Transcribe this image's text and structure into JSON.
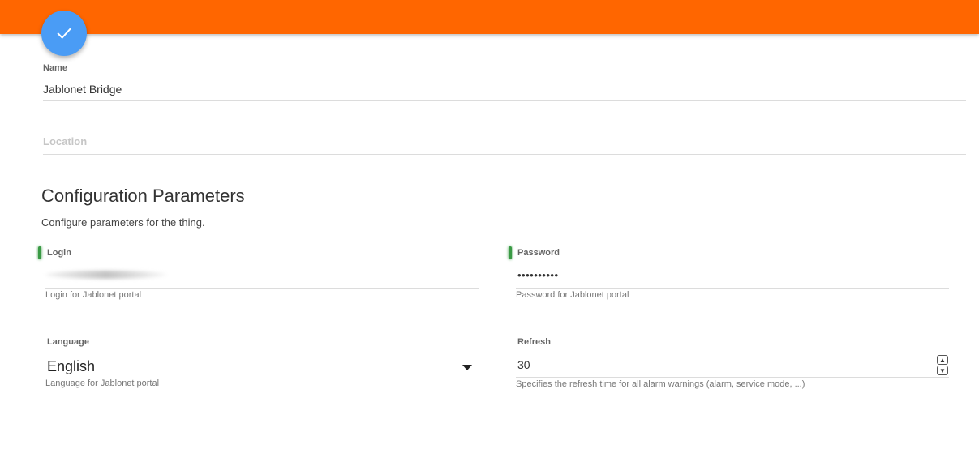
{
  "header": {
    "color": "#ff6600",
    "save_icon": "check-icon",
    "fab_color": "#4a9cf5"
  },
  "name": {
    "label": "Name",
    "value": "Jablonet Bridge"
  },
  "location": {
    "placeholder": "Location"
  },
  "config": {
    "title": "Configuration Parameters",
    "description": "Configure parameters for the thing.",
    "login": {
      "label": "Login",
      "helper": "Login for Jablonet portal"
    },
    "password": {
      "label": "Password",
      "value": "••••••••••",
      "helper": "Password for Jablonet portal"
    },
    "language": {
      "label": "Language",
      "value": "English",
      "helper": "Language for Jablonet portal"
    },
    "refresh": {
      "label": "Refresh",
      "value": "30",
      "helper": "Specifies the refresh time for all alarm warnings (alarm, service mode, ...)"
    }
  }
}
